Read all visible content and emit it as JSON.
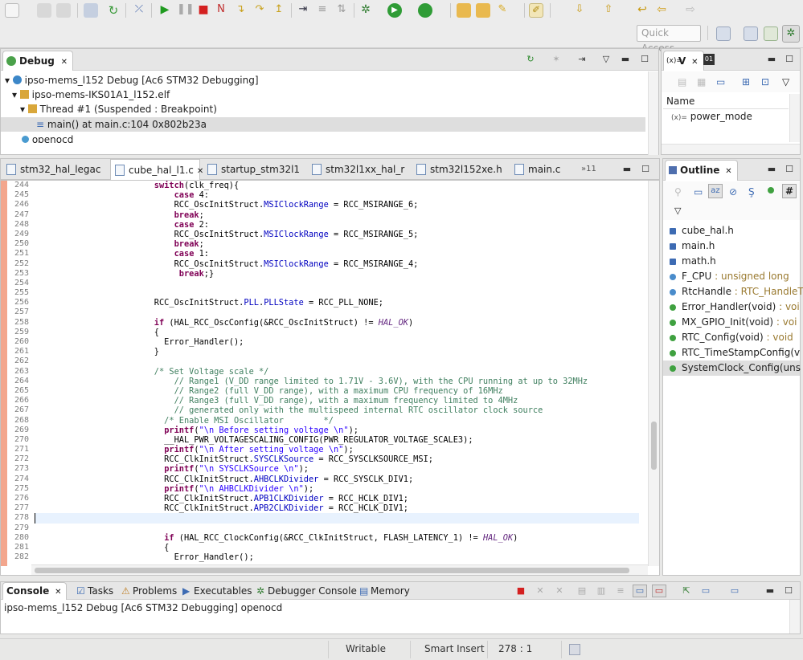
{
  "toolbar": {
    "quick_access": "Quick Access"
  },
  "debug": {
    "tab": "Debug",
    "items": [
      {
        "label": "ipso-mems_l152 Debug [Ac6 STM32 Debugging]"
      },
      {
        "label": "ipso-mems-IKS01A1_l152.elf"
      },
      {
        "label": "Thread #1 (Suspended : Breakpoint)"
      },
      {
        "label": "main() at main.c:104 0x802b23a"
      },
      {
        "label": "openocd"
      }
    ]
  },
  "variables": {
    "tab": "V",
    "tab2": "",
    "column": "Name",
    "row": "power_mode"
  },
  "editor_tabs": [
    {
      "label": "stm32_hal_legac"
    },
    {
      "label": "cube_hal_l1.c"
    },
    {
      "label": "startup_stm32l1"
    },
    {
      "label": "stm32l1xx_hal_r"
    },
    {
      "label": "stm32l152xe.h"
    },
    {
      "label": "main.c"
    },
    {
      "label": "»11"
    }
  ],
  "code": {
    "line_numbers": [
      "244",
      "245",
      "246",
      "247",
      "248",
      "249",
      "250",
      "251",
      "252",
      "253",
      "254",
      "255",
      "256",
      "257",
      "258",
      "259",
      "260",
      "261",
      "262",
      "263",
      "264",
      "265",
      "266",
      "267",
      "268",
      "269",
      "270",
      "271",
      "272",
      "273",
      "274",
      "275",
      "276",
      "277",
      "278",
      "279",
      "280",
      "281",
      "282"
    ],
    "lines": {
      "l244a": "                        ",
      "l244b": "switch",
      "l244c": "(clk_freq){",
      "l245a": "                            ",
      "l245b": "case",
      "l245c": " 4:",
      "l246a": "                            RCC_OscInitStruct.",
      "l246b": "MSIClockRange",
      "l246c": " = RCC_MSIRANGE_6;",
      "l247a": "                            ",
      "l247b": "break",
      "l247c": ";",
      "l248a": "                            ",
      "l248b": "case",
      "l248c": " 2:",
      "l249a": "                            RCC_OscInitStruct.",
      "l249b": "MSIClockRange",
      "l249c": " = RCC_MSIRANGE_5;",
      "l250a": "                            ",
      "l250b": "break",
      "l250c": ";",
      "l251a": "                            ",
      "l251b": "case",
      "l251c": " 1:",
      "l252a": "                            RCC_OscInitStruct.",
      "l252b": "MSIClockRange",
      "l252c": " = RCC_MSIRANGE_4;",
      "l253a": "                             ",
      "l253b": "break",
      "l253c": ";}",
      "l256a": "                        RCC_OscInitStruct.",
      "l256b": "PLL",
      "l256c": ".",
      "l256d": "PLLState",
      "l256e": " = RCC_PLL_NONE;",
      "l258a": "                        ",
      "l258b": "if",
      "l258c": " (HAL_RCC_OscConfig(&RCC_OscInitStruct) != ",
      "l258d": "HAL_OK",
      "l258e": ")",
      "l259": "                        {",
      "l260": "                          Error_Handler();",
      "l261": "                        }",
      "l263": "                        /* Set Voltage scale */",
      "l264": "                            // Range1 (V_DD range limited to 1.71V - 3.6V), with the CPU running at up to 32MHz",
      "l265": "                            // Range2 (full V_DD range), with a maximum CPU frequency of 16MHz",
      "l266": "                            // Range3 (full V_DD range), with a maximum frequency limited to 4MHz",
      "l267": "                            // generated only with the multispeed internal RTC oscillator clock source",
      "l268": "                          /* Enable MSI Oscillator        */",
      "l269a": "                          ",
      "l269b": "printf",
      "l269c": "(",
      "l269d": "\"\\n Before setting voltage \\n\"",
      "l269e": ");",
      "l270": "                          __HAL_PWR_VOLTAGESCALING_CONFIG(PWR_REGULATOR_VOLTAGE_SCALE3);",
      "l271a": "                          ",
      "l271b": "printf",
      "l271c": "(",
      "l271d": "\"\\n After setting voltage \\n\"",
      "l271e": ");",
      "l272a": "                          RCC_ClkInitStruct.",
      "l272b": "SYSCLKSource",
      "l272c": " = RCC_SYSCLKSOURCE_MSI;",
      "l273a": "                          ",
      "l273b": "printf",
      "l273c": "(",
      "l273d": "\"\\n SYSCLKSource \\n\"",
      "l273e": ");",
      "l274a": "                          RCC_ClkInitStruct.",
      "l274b": "AHBCLKDivider",
      "l274c": " = RCC_SYSCLK_DIV1;",
      "l275a": "                          ",
      "l275b": "printf",
      "l275c": "(",
      "l275d": "\"\\n AHBCLKDivider \\n\"",
      "l275e": ");",
      "l276a": "                          RCC_ClkInitStruct.",
      "l276b": "APB1CLKDivider",
      "l276c": " = RCC_HCLK_DIV1;",
      "l277a": "                          RCC_ClkInitStruct.",
      "l277b": "APB2CLKDivider",
      "l277c": " = RCC_HCLK_DIV1;",
      "l280a": "                          ",
      "l280b": "if",
      "l280c": " (HAL_RCC_ClockConfig(&RCC_ClkInitStruct, FLASH_LATENCY_1) != ",
      "l280d": "HAL_OK",
      "l280e": ")",
      "l281": "                          {",
      "l282": "                            Error_Handler();"
    }
  },
  "outline": {
    "tab": "Outline",
    "items": [
      {
        "name": "cube_hal.h",
        "type": ""
      },
      {
        "name": "main.h",
        "type": ""
      },
      {
        "name": "math.h",
        "type": ""
      },
      {
        "name": "F_CPU",
        "type": " : unsigned long"
      },
      {
        "name": "RtcHandle",
        "type": " : RTC_HandleT"
      },
      {
        "name": "Error_Handler(void)",
        "type": " : voi"
      },
      {
        "name": "MX_GPIO_Init(void)",
        "type": " : voi"
      },
      {
        "name": "RTC_Config(void)",
        "type": " : void"
      },
      {
        "name": "RTC_TimeStampConfig(v",
        "type": ""
      },
      {
        "name": "SystemClock_Config(uns",
        "type": ""
      }
    ]
  },
  "console": {
    "tabs": [
      {
        "label": "Console"
      },
      {
        "label": "Tasks"
      },
      {
        "label": "Problems"
      },
      {
        "label": "Executables"
      },
      {
        "label": "Debugger Console"
      },
      {
        "label": "Memory"
      }
    ],
    "text": "ipso-mems_l152 Debug [Ac6 STM32 Debugging] openocd"
  },
  "status": {
    "writable": "Writable",
    "insert": "Smart Insert",
    "position": "278 : 1"
  }
}
